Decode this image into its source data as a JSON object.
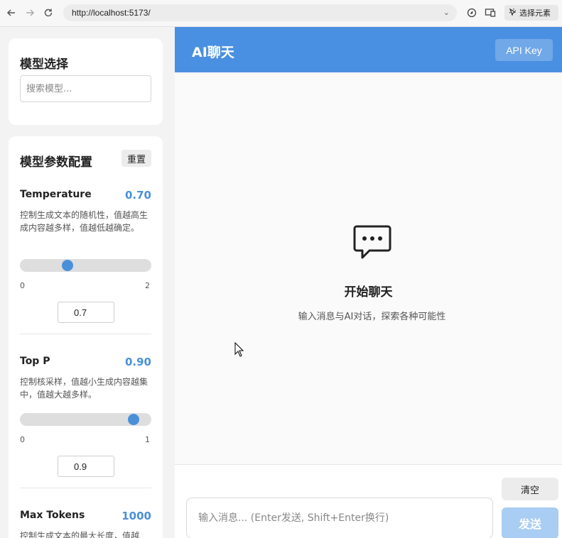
{
  "browser": {
    "url": "http://localhost:5173/",
    "select_element_label": "选择元素",
    "icons": [
      "back-arrow-icon",
      "forward-arrow-icon",
      "reload-icon",
      "compass-icon",
      "screen-share-icon",
      "cursor-select-icon"
    ]
  },
  "sidebar": {
    "model_card": {
      "title": "模型选择",
      "search_placeholder": "搜索模型..."
    },
    "params_card": {
      "title": "模型参数配置",
      "reset_label": "重置",
      "params": [
        {
          "name": "Temperature",
          "value_display": "0.70",
          "description": "控制生成文本的随机性，值越高生成内容越多样，值越低越确定。",
          "min": "0",
          "max": "2",
          "value": 0.7,
          "input_value": "0.7"
        },
        {
          "name": "Top P",
          "value_display": "0.90",
          "description": "控制核采样，值越小生成内容越集中，值越大越多样。",
          "min": "0",
          "max": "1",
          "value": 0.9,
          "input_value": "0.9"
        },
        {
          "name": "Max Tokens",
          "value_display": "1000",
          "description": "控制生成文本的最大长度，值越"
        }
      ]
    }
  },
  "chat": {
    "title": "AI聊天",
    "api_key_label": "API Key",
    "empty_title": "开始聊天",
    "empty_subtitle": "输入消息与AI对话，探索各种可能性",
    "clear_label": "清空",
    "input_placeholder": "输入消息... (Enter发送, Shift+Enter换行)",
    "send_label": "发送"
  },
  "colors": {
    "accent": "#4a90e2",
    "send_disabled": "#a9cdf3",
    "value_text": "#4a90d9"
  }
}
